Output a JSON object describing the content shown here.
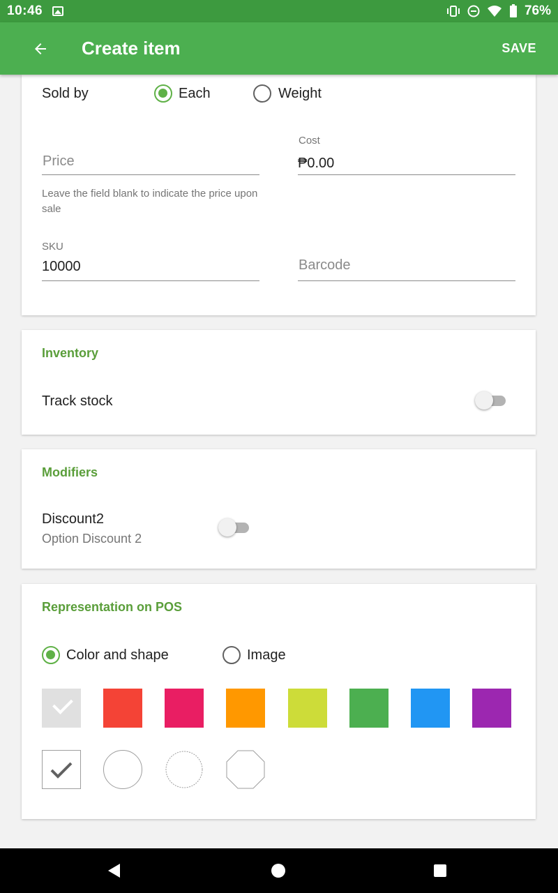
{
  "status_bar": {
    "time": "10:46",
    "battery": "76%",
    "icons": [
      "image-icon",
      "vibrate-icon",
      "do-not-disturb-icon",
      "wifi-icon",
      "battery-icon"
    ]
  },
  "app_bar": {
    "title": "Create item",
    "save_label": "SAVE",
    "back_icon": "arrow-back-icon",
    "color": "#4caf50"
  },
  "pricing": {
    "sold_by_label": "Sold by",
    "options": [
      {
        "label": "Each",
        "selected": true
      },
      {
        "label": "Weight",
        "selected": false
      }
    ],
    "price": {
      "placeholder": "Price",
      "value": "",
      "hint": "Leave the field blank to indicate the price upon sale"
    },
    "cost": {
      "label": "Cost",
      "value": "₱0.00"
    },
    "sku": {
      "label": "SKU",
      "value": "10000"
    },
    "barcode": {
      "placeholder": "Barcode",
      "value": ""
    }
  },
  "inventory": {
    "title": "Inventory",
    "track_stock_label": "Track stock",
    "track_stock_on": false
  },
  "modifiers": {
    "title": "Modifiers",
    "items": [
      {
        "name": "Discount2",
        "subtitle": "Option Discount 2",
        "enabled": false
      }
    ]
  },
  "representation": {
    "title": "Representation on POS",
    "options": [
      {
        "label": "Color and shape",
        "selected": true
      },
      {
        "label": "Image",
        "selected": false
      }
    ],
    "colors": [
      {
        "name": "grey",
        "hex": "#e0e0e0",
        "selected": true
      },
      {
        "name": "red",
        "hex": "#f44336",
        "selected": false
      },
      {
        "name": "pink",
        "hex": "#e91e63",
        "selected": false
      },
      {
        "name": "orange",
        "hex": "#ff9800",
        "selected": false
      },
      {
        "name": "lime",
        "hex": "#cddc39",
        "selected": false
      },
      {
        "name": "green",
        "hex": "#4caf50",
        "selected": false
      },
      {
        "name": "blue",
        "hex": "#2196f3",
        "selected": false
      },
      {
        "name": "purple",
        "hex": "#9c27b0",
        "selected": false
      }
    ],
    "shapes": [
      {
        "name": "square",
        "selected": true
      },
      {
        "name": "circle",
        "selected": false
      },
      {
        "name": "sun",
        "selected": false
      },
      {
        "name": "octagon",
        "selected": false
      }
    ]
  },
  "accent_color": "#5fb147",
  "nav_bar": {
    "buttons": [
      "back-triangle-icon",
      "home-circle-icon",
      "recents-square-icon"
    ]
  }
}
